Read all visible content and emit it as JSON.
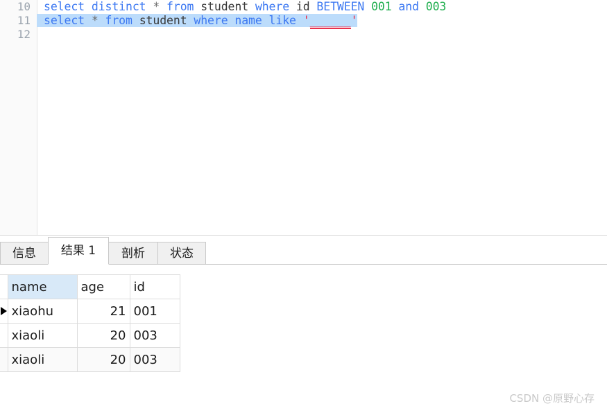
{
  "editor": {
    "lines": [
      {
        "number": "10",
        "selected": false,
        "tokens": [
          {
            "text": "select ",
            "kind": "kw"
          },
          {
            "text": "distinct ",
            "kind": "kw"
          },
          {
            "text": "* ",
            "kind": "op"
          },
          {
            "text": "from ",
            "kind": "kw"
          },
          {
            "text": "student ",
            "kind": "id"
          },
          {
            "text": "where ",
            "kind": "kw"
          },
          {
            "text": "id ",
            "kind": "id"
          },
          {
            "text": "BETWEEN ",
            "kind": "kw"
          },
          {
            "text": "001 ",
            "kind": "num"
          },
          {
            "text": "and ",
            "kind": "kw"
          },
          {
            "text": "003",
            "kind": "num"
          }
        ]
      },
      {
        "number": "11",
        "selected": true,
        "tokens": [
          {
            "text": "select ",
            "kind": "kw"
          },
          {
            "text": "* ",
            "kind": "op"
          },
          {
            "text": "from ",
            "kind": "kw"
          },
          {
            "text": "student ",
            "kind": "id"
          },
          {
            "text": "where ",
            "kind": "kw"
          },
          {
            "text": "name ",
            "kind": "kw"
          },
          {
            "text": "like ",
            "kind": "kw"
          },
          {
            "text": "'",
            "kind": "str"
          },
          {
            "text": "______",
            "kind": "str-underline"
          },
          {
            "text": "'",
            "kind": "str"
          }
        ]
      },
      {
        "number": "12",
        "selected": false,
        "tokens": []
      }
    ]
  },
  "tabs": [
    {
      "label": "信息",
      "active": false
    },
    {
      "label": "结果 1",
      "active": true
    },
    {
      "label": "剖析",
      "active": false
    },
    {
      "label": "状态",
      "active": false
    }
  ],
  "result_grid": {
    "columns": [
      {
        "label": "name",
        "selected": true
      },
      {
        "label": "age",
        "selected": false
      },
      {
        "label": "id",
        "selected": false
      }
    ],
    "rows": [
      {
        "current": true,
        "name": "xiaohu",
        "age": "21",
        "id": "001"
      },
      {
        "current": false,
        "name": "xiaoli",
        "age": "20",
        "id": "003"
      },
      {
        "current": false,
        "name": "xiaoli",
        "age": "20",
        "id": "003"
      }
    ]
  },
  "watermark": {
    "text": "CSDN @原野心存"
  },
  "colors": {
    "keyword": "#3d79f2",
    "number": "#1fae4e",
    "string": "#e8304d",
    "identifier": "#3a3a3a",
    "selection": "#bcdcfb",
    "column_selected": "#d8e9f8"
  }
}
